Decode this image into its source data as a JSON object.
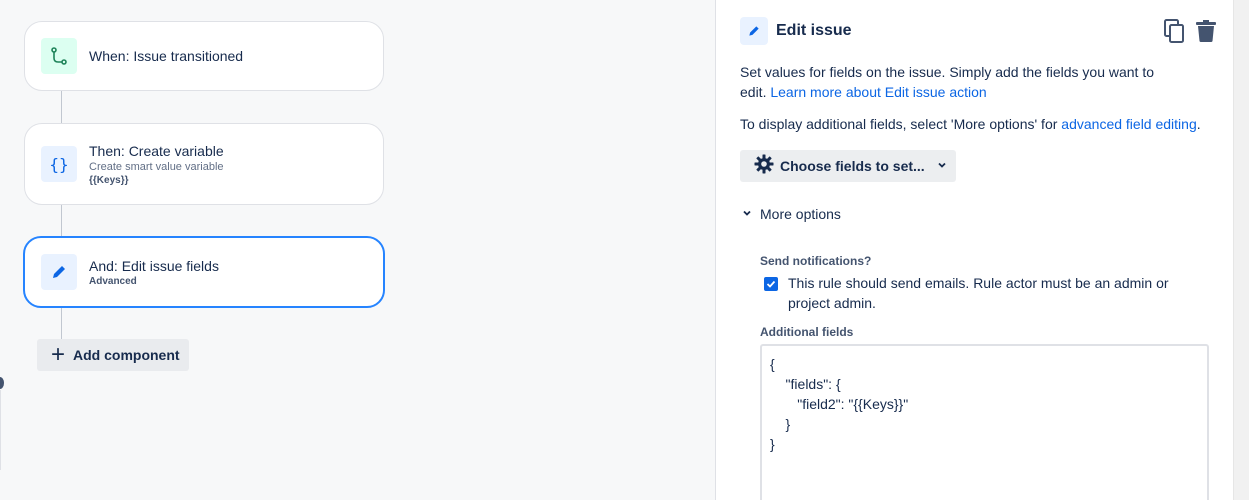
{
  "flow": {
    "trigger": {
      "title": "When: Issue transitioned"
    },
    "action1": {
      "title": "Then: Create variable",
      "subtitle": "Create smart value variable",
      "detail": "{{Keys}}"
    },
    "action2": {
      "title": "And: Edit issue fields",
      "detail": "Advanced"
    },
    "add_component_label": "Add component"
  },
  "panel": {
    "title": "Edit issue",
    "description_text": "Set values for fields on the issue. Simply add the fields you want to edit.",
    "description_link": "Learn more about Edit issue action",
    "additional_text": "To display additional fields, select 'More options' for",
    "additional_link": "advanced field editing",
    "additional_end": ".",
    "choose_fields_label": "Choose fields to set...",
    "more_options_label": "More options",
    "send_notifications_label": "Send notifications?",
    "send_notifications_checkbox": "This rule should send emails. Rule actor must be an admin or project admin.",
    "additional_fields_label": "Additional fields",
    "additional_fields_value": "{\n    \"fields\": {\n       \"field2\": \"{{Keys}}\"\n    }\n}"
  },
  "colors": {
    "accent": "#0c66e4",
    "selected_border": "#2684ff",
    "trigger_icon_bg": "#dcfff1",
    "action_icon_bg": "#e9f2ff"
  },
  "icons": {
    "trigger": "branch-icon",
    "variable": "braces-icon",
    "edit": "pencil-icon",
    "copy": "copy-icon",
    "delete": "trash-icon",
    "settings": "gear-icon",
    "chevron": "chevron-down-icon"
  }
}
